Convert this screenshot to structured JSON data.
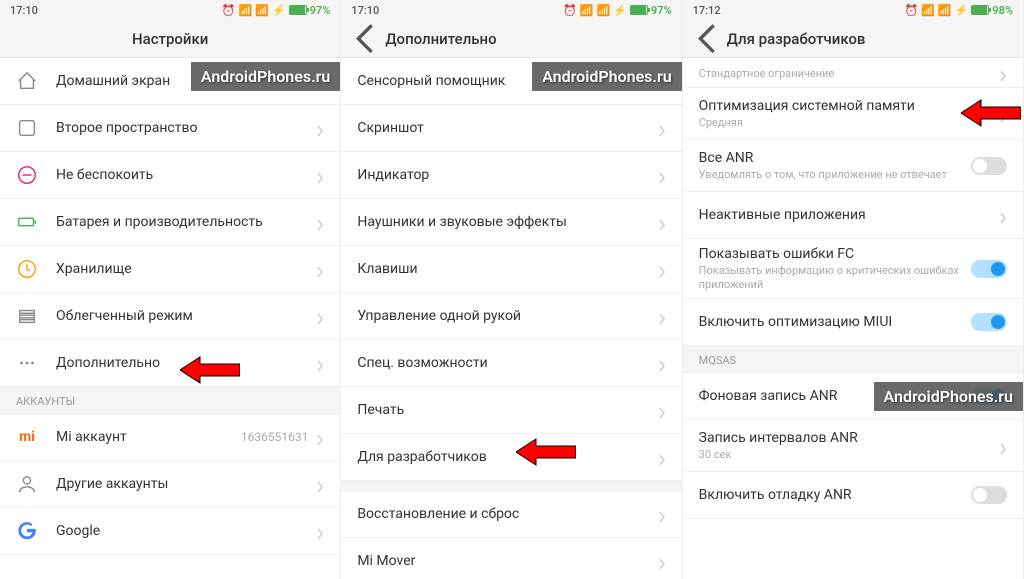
{
  "watermark": "AndroidPhones.ru",
  "screens": [
    {
      "time": "17:10",
      "battery": "97%",
      "title": "Настройки",
      "sections": [
        {
          "type": "rows",
          "rows": [
            {
              "icon": "home",
              "label": "Домашний экран"
            },
            {
              "icon": "square",
              "label": "Второе пространство"
            },
            {
              "icon": "dnd",
              "label": "Не беспокоить"
            },
            {
              "icon": "battery",
              "label": "Батарея и производительность"
            },
            {
              "icon": "clock",
              "label": "Хранилище"
            },
            {
              "icon": "lite",
              "label": "Облегченный режим"
            },
            {
              "icon": "dots",
              "label": "Дополнительно",
              "arrow": true
            }
          ]
        },
        {
          "type": "header",
          "label": "АККАУНТЫ"
        },
        {
          "type": "rows",
          "rows": [
            {
              "icon": "mi",
              "label": "Mi аккаунт",
              "value": "1636551631"
            },
            {
              "icon": "user",
              "label": "Другие аккаунты"
            },
            {
              "icon": "google",
              "label": "Google"
            }
          ]
        }
      ]
    },
    {
      "time": "17:10",
      "battery": "97%",
      "title": "Дополнительно",
      "back": true,
      "sections": [
        {
          "type": "rows",
          "rows": [
            {
              "label": "Сенсорный помощник"
            },
            {
              "label": "Скриншот"
            },
            {
              "label": "Индикатор"
            },
            {
              "label": "Наушники и звуковые эффекты"
            },
            {
              "label": "Клавиши"
            },
            {
              "label": "Управление одной рукой"
            },
            {
              "label": "Спец. возможности"
            },
            {
              "label": "Печать"
            },
            {
              "label": "Для разработчиков",
              "arrow": true
            }
          ]
        },
        {
          "type": "gap"
        },
        {
          "type": "rows",
          "rows": [
            {
              "label": "Восстановление и сброс"
            },
            {
              "label": "Mi Mover"
            }
          ]
        }
      ]
    },
    {
      "time": "17:12",
      "battery": "98%",
      "title": "Для разработчиков",
      "back": true,
      "sections": [
        {
          "type": "rows",
          "rows": [
            {
              "sub": "Стандартное ограничение",
              "label": ""
            },
            {
              "label": "Оптимизация системной памяти",
              "sub": "Средняя",
              "arrow": true
            },
            {
              "label": "Все ANR",
              "sub": "Уведомлять о том, что приложение не отвечает",
              "toggle": "off"
            },
            {
              "label": "Неактивные приложения",
              "chevron": true
            },
            {
              "label": "Показывать ошибки FC",
              "sub": "Показывать информацию о критических ошибках приложений",
              "toggle": "on"
            },
            {
              "label": "Включить оптимизацию MIUI",
              "toggle": "on"
            }
          ]
        },
        {
          "type": "header",
          "label": "MQSAS"
        },
        {
          "type": "rows",
          "rows": [
            {
              "label": "Фоновая запись ANR",
              "toggle": "on"
            },
            {
              "label": "Запись интервалов ANR",
              "sub": "30 сек"
            },
            {
              "label": "Включить отладку ANR",
              "toggle": "off"
            }
          ]
        }
      ]
    }
  ]
}
